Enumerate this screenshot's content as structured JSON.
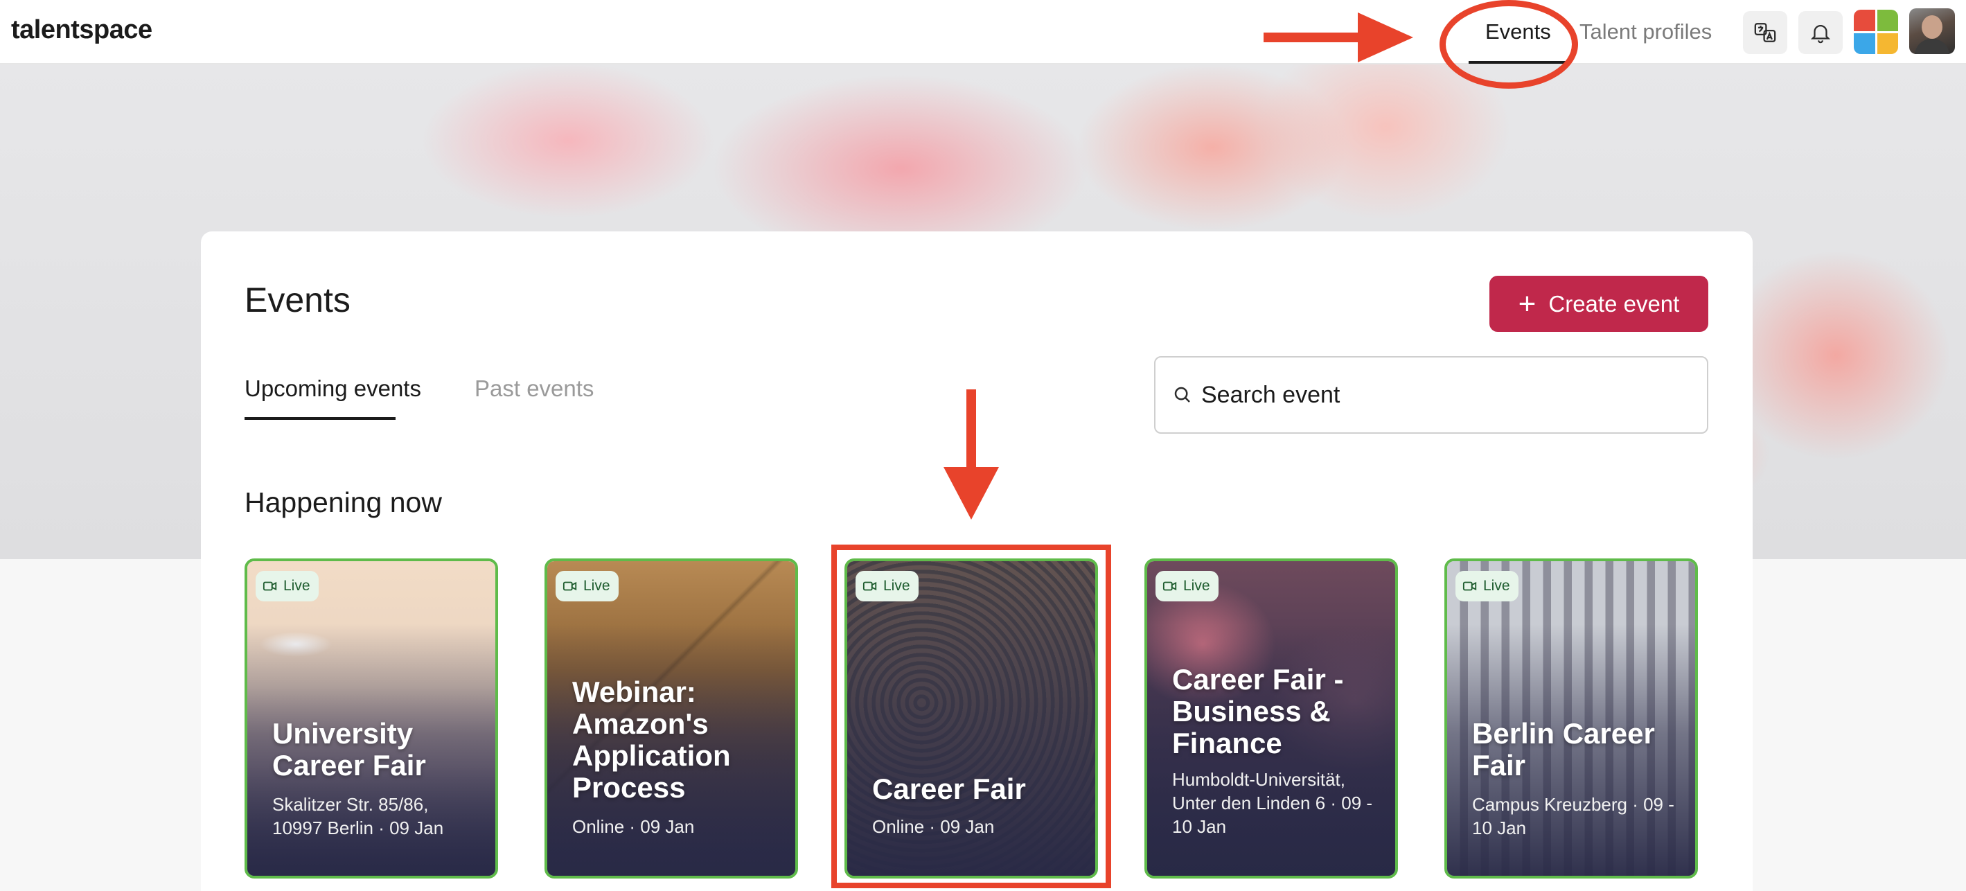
{
  "app": {
    "logo": "talentspace"
  },
  "nav": {
    "events_label": "Events",
    "talent_label": "Talent profiles",
    "icons": [
      "translate-icon",
      "bell-icon",
      "apps-icon"
    ]
  },
  "page": {
    "title": "Events",
    "create_label": "Create event",
    "tabs": {
      "upcoming": "Upcoming events",
      "past": "Past events"
    },
    "search_placeholder": "Search event",
    "section_title": "Happening now"
  },
  "events": [
    {
      "badge": "Live",
      "title": "University Career Fair",
      "meta": "Skalitzer Str. 85/86, 10997 Berlin · 09 Jan"
    },
    {
      "badge": "Live",
      "title": "Webinar: Amazon's Application Process",
      "meta": "Online · 09 Jan"
    },
    {
      "badge": "Live",
      "title": "Career Fair",
      "meta": "Online · 09 Jan"
    },
    {
      "badge": "Live",
      "title": "Career Fair - Business & Finance",
      "meta": "Humboldt-Universität, Unter den Linden 6 · 09 - 10 Jan"
    },
    {
      "badge": "Live",
      "title": "Berlin Career Fair",
      "meta": "Campus Kreuzberg · 09 - 10 Jan"
    }
  ],
  "colors": {
    "brand": "#c0284b",
    "live_border": "#5fbb4a",
    "annotation": "#e8432b"
  }
}
